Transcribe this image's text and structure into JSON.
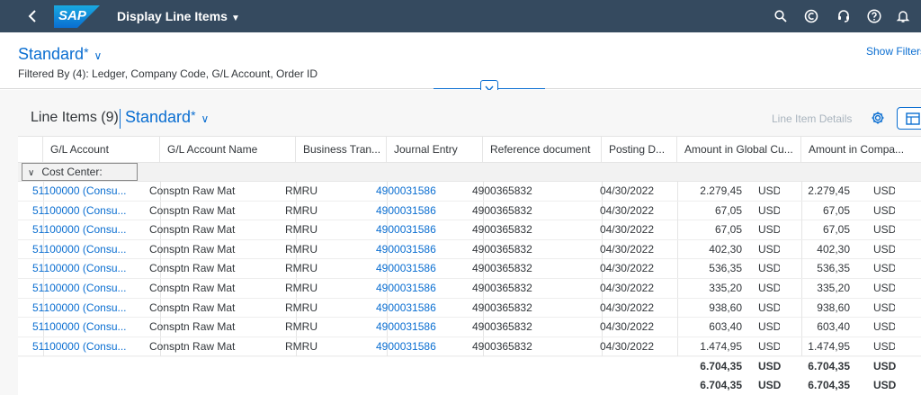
{
  "shell": {
    "back_icon": "chevron-left-icon",
    "logo_text": "SAP",
    "title": "Display Line Items",
    "icons": [
      "search-icon",
      "copilot-icon",
      "help-headset-icon",
      "help-icon",
      "notification-icon"
    ],
    "brand_color": "#354a5f"
  },
  "header": {
    "variant": "Standard",
    "variant_star": "*",
    "filtered_by": "Filtered By (4): Ledger, Company Code, G/L Account, Order ID",
    "show_filters": "Show Filters"
  },
  "toolbar": {
    "title": "Line Items (9)",
    "variant": "Standard",
    "variant_star": "*",
    "line_item_details": "Line Item Details"
  },
  "table": {
    "columns": [
      "G/L Account",
      "G/L Account Name",
      "Business Tran...",
      "Journal Entry",
      "Reference document",
      "Posting D...",
      "Amount in Global Cu...",
      "Amount in Compa..."
    ],
    "group_label": "Cost Center:",
    "rows": [
      {
        "gl": "51100000 (Consu...",
        "name": "Consptn Raw Mat",
        "btran": "RMRU",
        "je": "4900031586",
        "ref": "4900365832",
        "date": "04/30/2022",
        "amt_g": "2.279,45",
        "cur_g": "USD",
        "amt_c": "2.279,45",
        "cur_c": "USD"
      },
      {
        "gl": "51100000 (Consu...",
        "name": "Consptn Raw Mat",
        "btran": "RMRU",
        "je": "4900031586",
        "ref": "4900365832",
        "date": "04/30/2022",
        "amt_g": "67,05",
        "cur_g": "USD",
        "amt_c": "67,05",
        "cur_c": "USD"
      },
      {
        "gl": "51100000 (Consu...",
        "name": "Consptn Raw Mat",
        "btran": "RMRU",
        "je": "4900031586",
        "ref": "4900365832",
        "date": "04/30/2022",
        "amt_g": "67,05",
        "cur_g": "USD",
        "amt_c": "67,05",
        "cur_c": "USD"
      },
      {
        "gl": "51100000 (Consu...",
        "name": "Consptn Raw Mat",
        "btran": "RMRU",
        "je": "4900031586",
        "ref": "4900365832",
        "date": "04/30/2022",
        "amt_g": "402,30",
        "cur_g": "USD",
        "amt_c": "402,30",
        "cur_c": "USD"
      },
      {
        "gl": "51100000 (Consu...",
        "name": "Consptn Raw Mat",
        "btran": "RMRU",
        "je": "4900031586",
        "ref": "4900365832",
        "date": "04/30/2022",
        "amt_g": "536,35",
        "cur_g": "USD",
        "amt_c": "536,35",
        "cur_c": "USD"
      },
      {
        "gl": "51100000 (Consu...",
        "name": "Consptn Raw Mat",
        "btran": "RMRU",
        "je": "4900031586",
        "ref": "4900365832",
        "date": "04/30/2022",
        "amt_g": "335,20",
        "cur_g": "USD",
        "amt_c": "335,20",
        "cur_c": "USD"
      },
      {
        "gl": "51100000 (Consu...",
        "name": "Consptn Raw Mat",
        "btran": "RMRU",
        "je": "4900031586",
        "ref": "4900365832",
        "date": "04/30/2022",
        "amt_g": "938,60",
        "cur_g": "USD",
        "amt_c": "938,60",
        "cur_c": "USD"
      },
      {
        "gl": "51100000 (Consu...",
        "name": "Consptn Raw Mat",
        "btran": "RMRU",
        "je": "4900031586",
        "ref": "4900365832",
        "date": "04/30/2022",
        "amt_g": "603,40",
        "cur_g": "USD",
        "amt_c": "603,40",
        "cur_c": "USD"
      },
      {
        "gl": "51100000 (Consu...",
        "name": "Consptn Raw Mat",
        "btran": "RMRU",
        "je": "4900031586",
        "ref": "4900365832",
        "date": "04/30/2022",
        "amt_g": "1.474,95",
        "cur_g": "USD",
        "amt_c": "1.474,95",
        "cur_c": "USD"
      }
    ],
    "subtotal": {
      "amt_g": "6.704,35",
      "cur_g": "USD",
      "amt_c": "6.704,35",
      "cur_c": "USD"
    },
    "total": {
      "amt_g": "6.704,35",
      "cur_g": "USD",
      "amt_c": "6.704,35",
      "cur_c": "USD"
    }
  }
}
